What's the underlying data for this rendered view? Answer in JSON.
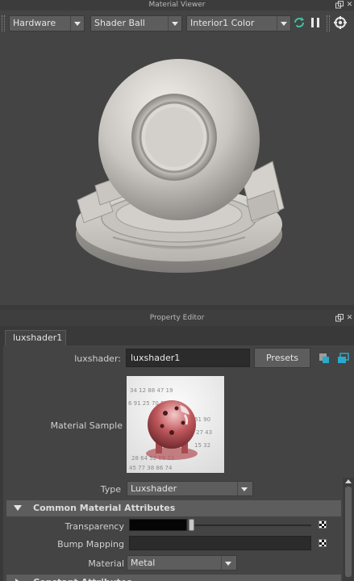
{
  "material_viewer": {
    "title": "Material Viewer",
    "renderer": "Hardware",
    "geometry": "Shader Ball",
    "environment": "Interior1 Color",
    "icons": [
      "refresh-icon",
      "pause-icon",
      "render-settings-icon"
    ]
  },
  "property_editor": {
    "title": "Property Editor",
    "tab_label": "luxshader1",
    "node_type_label": "luxshader:",
    "node_name": "luxshader1",
    "presets_label": "Presets",
    "material_sample_label": "Material Sample",
    "type_label": "Type",
    "type_value": "Luxshader",
    "common_section": "Common Material Attributes",
    "transparency_label": "Transparency",
    "transparency_slider": 0.29,
    "bump_label": "Bump Mapping",
    "material_label": "Material",
    "material_value": "Metal",
    "collapsed_section": "Constant Attributes"
  },
  "colors": {
    "panel_bg": "#444444",
    "field_bg": "#2b2b2b",
    "section_bg": "#5d5d5d",
    "sample_sphere": "#c0585c"
  }
}
